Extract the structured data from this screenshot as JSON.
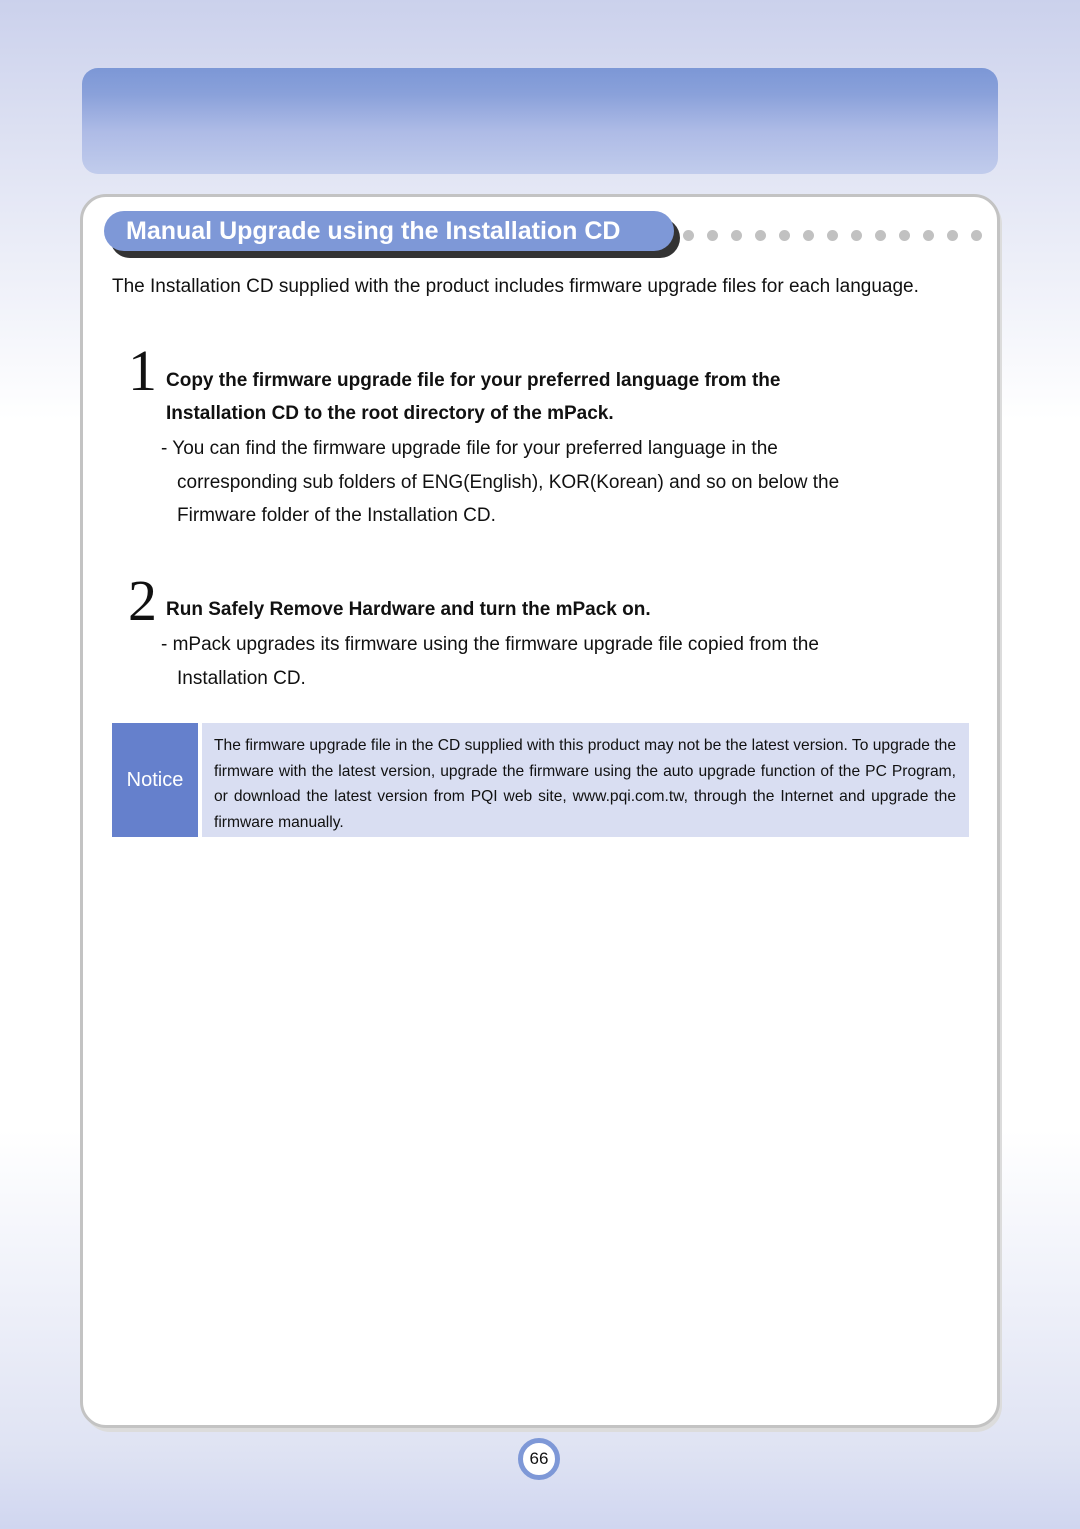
{
  "header": {},
  "section": {
    "title": "Manual Upgrade using the Installation CD",
    "dot_count": 13
  },
  "intro": "The Installation CD supplied with the product includes firmware upgrade files for each language.",
  "steps": [
    {
      "number": "1",
      "title_lines": [
        "Copy the firmware upgrade file for your preferred language from the",
        "Installation CD to the root directory of the mPack."
      ],
      "desc_lines": [
        "- You can find the firmware upgrade file for your preferred language in the",
        "corresponding sub folders of ENG(English), KOR(Korean) and so on below the",
        "Firmware folder of the Installation CD."
      ]
    },
    {
      "number": "2",
      "title_lines": [
        "Run Safely Remove Hardware and turn the mPack on."
      ],
      "desc_lines": [
        "- mPack upgrades its firmware using the firmware upgrade file copied from the",
        "Installation CD."
      ]
    }
  ],
  "notice": {
    "label": "Notice",
    "text": "The firmware upgrade file in the CD supplied with this product may not be the latest version. To upgrade the firmware with the latest version, upgrade the firmware using the auto upgrade function of the PC Program, or download the latest version from PQI web site, www.pqi.com.tw, through the Internet and upgrade the firmware manually."
  },
  "page_number": "66",
  "colors": {
    "accent": "#7e98d7",
    "notice_label_bg": "#6580cc",
    "notice_box_bg": "#d9def2",
    "dot": "#c1c1c1",
    "panel_border": "#c3c3c3"
  }
}
